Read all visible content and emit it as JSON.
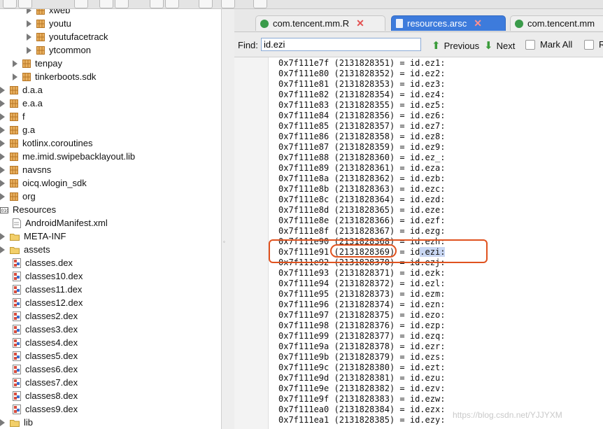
{
  "tree": {
    "items": [
      {
        "label": "xweb",
        "type": "package",
        "expandable": true
      },
      {
        "label": "youtu",
        "type": "package",
        "expandable": true
      },
      {
        "label": "youtufacetrack",
        "type": "package",
        "expandable": true
      },
      {
        "label": "ytcommon",
        "type": "package",
        "expandable": true
      },
      {
        "label": "tenpay",
        "type": "package",
        "expandable": true
      },
      {
        "label": "tinkerboots.sdk",
        "type": "package",
        "expandable": true
      },
      {
        "label": "d.a.a",
        "type": "package",
        "expandable": true
      },
      {
        "label": "e.a.a",
        "type": "package",
        "expandable": true
      },
      {
        "label": "f",
        "type": "package",
        "expandable": true
      },
      {
        "label": "g.a",
        "type": "package",
        "expandable": true
      },
      {
        "label": "kotlinx.coroutines",
        "type": "package",
        "expandable": true
      },
      {
        "label": "me.imid.swipebacklayout.lib",
        "type": "package",
        "expandable": true
      },
      {
        "label": "navsns",
        "type": "package",
        "expandable": true
      },
      {
        "label": "oicq.wlogin_sdk",
        "type": "package",
        "expandable": true
      },
      {
        "label": "org",
        "type": "package",
        "expandable": true
      },
      {
        "label": "Resources",
        "type": "resources",
        "expandable": false
      },
      {
        "label": "AndroidManifest.xml",
        "type": "file",
        "expandable": false
      },
      {
        "label": "META-INF",
        "type": "folder",
        "expandable": false
      },
      {
        "label": "assets",
        "type": "folder",
        "expandable": false
      },
      {
        "label": "classes.dex",
        "type": "dex",
        "expandable": false
      },
      {
        "label": "classes10.dex",
        "type": "dex",
        "expandable": false
      },
      {
        "label": "classes11.dex",
        "type": "dex",
        "expandable": false
      },
      {
        "label": "classes12.dex",
        "type": "dex",
        "expandable": false
      },
      {
        "label": "classes2.dex",
        "type": "dex",
        "expandable": false
      },
      {
        "label": "classes3.dex",
        "type": "dex",
        "expandable": false
      },
      {
        "label": "classes4.dex",
        "type": "dex",
        "expandable": false
      },
      {
        "label": "classes5.dex",
        "type": "dex",
        "expandable": false
      },
      {
        "label": "classes6.dex",
        "type": "dex",
        "expandable": false
      },
      {
        "label": "classes7.dex",
        "type": "dex",
        "expandable": false
      },
      {
        "label": "classes8.dex",
        "type": "dex",
        "expandable": false
      },
      {
        "label": "classes9.dex",
        "type": "dex",
        "expandable": false
      },
      {
        "label": "lib",
        "type": "folder",
        "expandable": false
      }
    ]
  },
  "tabs": [
    {
      "label": "com.tencent.mm.R",
      "icon": "class-icon",
      "active": false
    },
    {
      "label": "resources.arsc",
      "icon": "file-icon",
      "active": true
    },
    {
      "label": "com.tencent.mm",
      "icon": "class-icon",
      "active": false
    }
  ],
  "find": {
    "label": "Find:",
    "value": "id.ezi",
    "previous_label": "Previous",
    "next_label": "Next",
    "mark_all_label": "Mark All",
    "regex_label": "R"
  },
  "code": {
    "lines": [
      "0x7f111e7f (2131828351) = id.ez1:",
      "0x7f111e80 (2131828352) = id.ez2:",
      "0x7f111e81 (2131828353) = id.ez3:",
      "0x7f111e82 (2131828354) = id.ez4:",
      "0x7f111e83 (2131828355) = id.ez5:",
      "0x7f111e84 (2131828356) = id.ez6:",
      "0x7f111e85 (2131828357) = id.ez7:",
      "0x7f111e86 (2131828358) = id.ez8:",
      "0x7f111e87 (2131828359) = id.ez9:",
      "0x7f111e88 (2131828360) = id.ez_:",
      "0x7f111e89 (2131828361) = id.eza:",
      "0x7f111e8a (2131828362) = id.ezb:",
      "0x7f111e8b (2131828363) = id.ezc:",
      "0x7f111e8c (2131828364) = id.ezd:",
      "0x7f111e8d (2131828365) = id.eze:",
      "0x7f111e8e (2131828366) = id.ezf:",
      "0x7f111e8f (2131828367) = id.ezg:",
      "0x7f111e90 (2131828368) = id.ezh:",
      "0x7f111e91 (2131828369) = id.ezi:",
      "0x7f111e92 (2131828370) = id.ezj:",
      "0x7f111e93 (2131828371) = id.ezk:",
      "0x7f111e94 (2131828372) = id.ezl:",
      "0x7f111e95 (2131828373) = id.ezm:",
      "0x7f111e96 (2131828374) = id.ezn:",
      "0x7f111e97 (2131828375) = id.ezo:",
      "0x7f111e98 (2131828376) = id.ezp:",
      "0x7f111e99 (2131828377) = id.ezq:",
      "0x7f111e9a (2131828378) = id.ezr:",
      "0x7f111e9b (2131828379) = id.ezs:",
      "0x7f111e9c (2131828380) = id.ezt:",
      "0x7f111e9d (2131828381) = id.ezu:",
      "0x7f111e9e (2131828382) = id.ezv:",
      "0x7f111e9f (2131828383) = id.ezw:",
      "0x7f111ea0 (2131828384) = id.ezx:",
      "0x7f111ea1 (2131828385) = id.ezy:"
    ],
    "highlighted_line_index": 18
  },
  "watermark": "https://blog.csdn.net/YJJYXM",
  "colors": {
    "active_tab": "#3d7bdc",
    "annotation": "#e0521f",
    "selection": "#c9d7f3",
    "package_icon": "#c9822a"
  }
}
